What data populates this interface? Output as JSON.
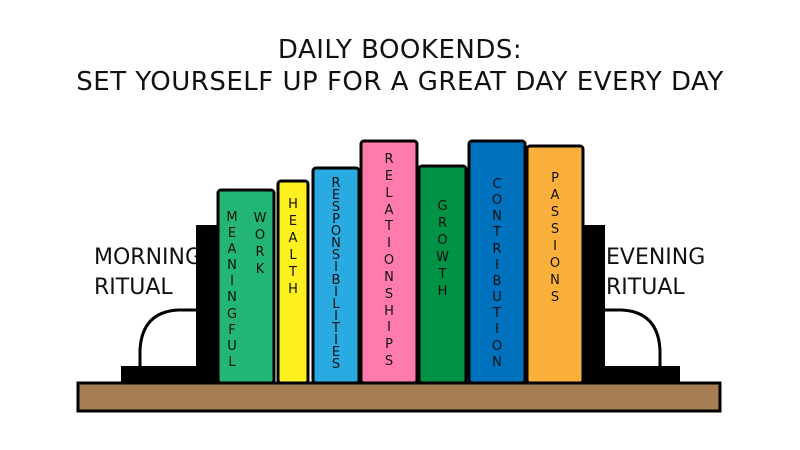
{
  "title": {
    "line1": "DAILY BOOKENDS:",
    "line2": "SET YOURSELF UP FOR A GREAT DAY EVERY DAY"
  },
  "bookends": {
    "left": {
      "line1": "MORNING",
      "line2": "RITUAL"
    },
    "right": {
      "line1": "EVENING",
      "line2": "RITUAL"
    }
  },
  "books": [
    {
      "label_lines": [
        "MEANINGFUL",
        "WORK"
      ],
      "color": "#22b573"
    },
    {
      "label_lines": [
        "HEALTH"
      ],
      "color": "#fff01f"
    },
    {
      "label_lines": [
        "RESPONSIBILITIES"
      ],
      "color": "#29aae1"
    },
    {
      "label_lines": [
        "RELATIONSHIPS"
      ],
      "color": "#ff7bac"
    },
    {
      "label_lines": [
        "GROWTH"
      ],
      "color": "#009245"
    },
    {
      "label_lines": [
        "CONTRIBUTION"
      ],
      "color": "#0071bc"
    },
    {
      "label_lines": [
        "PASSIONS"
      ],
      "color": "#fbb03b"
    }
  ],
  "shelf_color": "#a67c52",
  "bookend_color": "#000000"
}
